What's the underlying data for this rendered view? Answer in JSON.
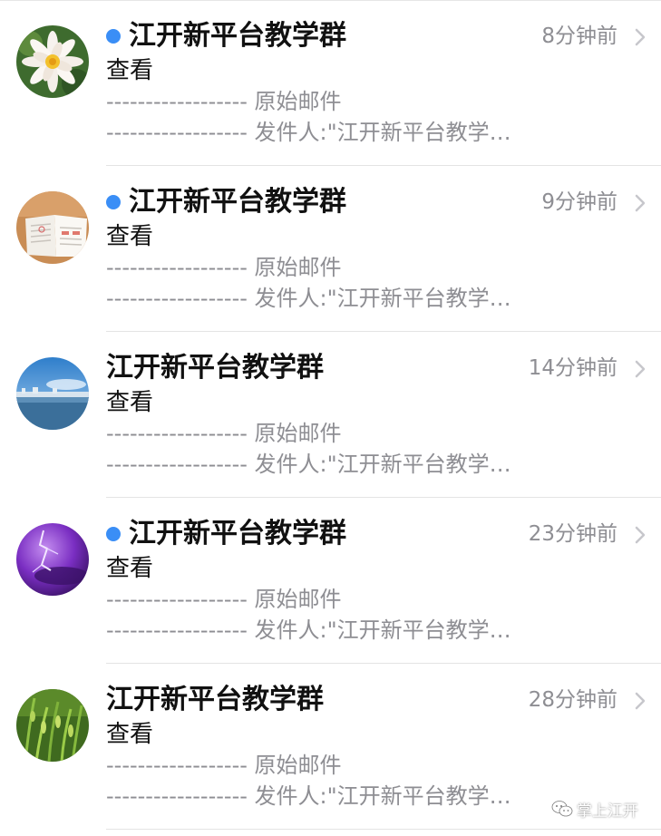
{
  "mail_items": [
    {
      "sender": "江开新平台教学群",
      "time": "8分钟前",
      "unread": true,
      "subject": "查看",
      "preview_line1": "------------------ 原始邮件",
      "preview_line2": "------------------ 发件人:\"江开新平台教学…",
      "avatar_icon": "water-lily-avatar"
    },
    {
      "sender": "江开新平台教学群",
      "time": "9分钟前",
      "unread": true,
      "subject": "查看",
      "preview_line1": "------------------ 原始邮件",
      "preview_line2": "------------------ 发件人:\"江开新平台教学…",
      "avatar_icon": "open-book-avatar"
    },
    {
      "sender": "江开新平台教学群",
      "time": "14分钟前",
      "unread": false,
      "subject": "查看",
      "preview_line1": "------------------ 原始邮件",
      "preview_line2": "------------------ 发件人:\"江开新平台教学…",
      "avatar_icon": "lake-sky-avatar"
    },
    {
      "sender": "江开新平台教学群",
      "time": "23分钟前",
      "unread": true,
      "subject": "查看",
      "preview_line1": "------------------ 原始邮件",
      "preview_line2": "------------------ 发件人:\"江开新平台教学…",
      "avatar_icon": "purple-lightning-avatar"
    },
    {
      "sender": "江开新平台教学群",
      "time": "28分钟前",
      "unread": false,
      "subject": "查看",
      "preview_line1": "------------------ 原始邮件",
      "preview_line2": "------------------ 发件人:\"江开新平台教学…",
      "avatar_icon": "green-grass-avatar"
    }
  ],
  "watermark": {
    "text": "掌上江开",
    "icon": "wechat-icon"
  },
  "colors": {
    "unread_dot": "#3a8ef6",
    "secondary_text": "#8e8e93",
    "primary_text": "#111111"
  }
}
